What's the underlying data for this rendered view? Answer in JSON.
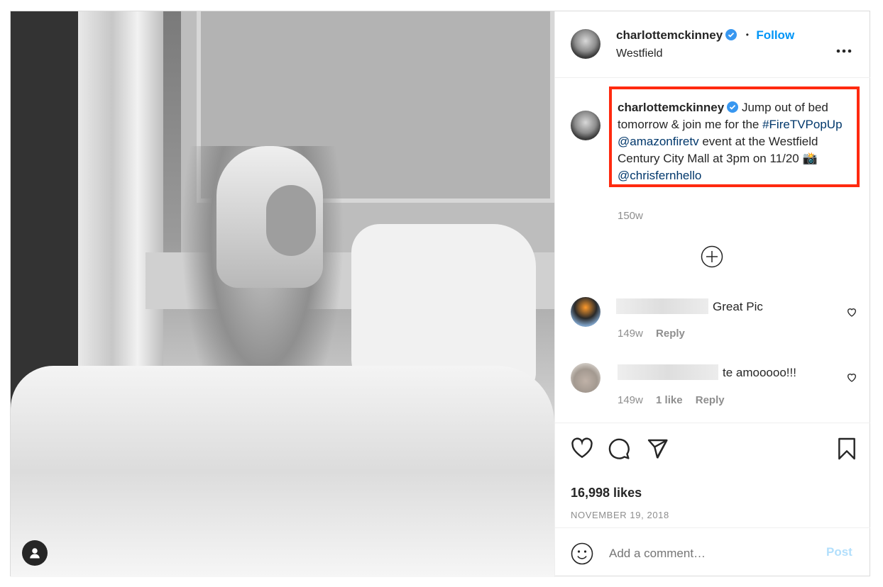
{
  "post": {
    "author": "charlottemckinney",
    "location": "Westfield",
    "follow_label": "Follow",
    "separator": "•",
    "more_label": "•••"
  },
  "caption": {
    "author": "charlottemckinney",
    "text_1": "Jump out of bed tomorrow & join me for the",
    "hashtag": "#FireTVPopUp",
    "mention_1": "@amazonfiretv",
    "text_2": "event at the Westfield Century City Mall at 3pm on 11/20",
    "emoji": "📸",
    "mention_2": "@chrisfernhello",
    "time": "150w"
  },
  "comments": [
    {
      "text": "Great Pic",
      "time": "149w",
      "reply_label": "Reply"
    },
    {
      "text": "te amooooo!!!",
      "time": "149w",
      "likes": "1 like",
      "reply_label": "Reply"
    }
  ],
  "stats": {
    "likes": "16,998 likes",
    "date": "NOVEMBER 19, 2018"
  },
  "add_comment": {
    "placeholder": "Add a comment…",
    "post_label": "Post"
  },
  "colors": {
    "link": "#00376b",
    "follow": "#0095f6",
    "highlight_box": "#ff2a0f",
    "post_disabled": "#b2dffc"
  },
  "icons": [
    "verified-badge-icon",
    "more-icon",
    "load-more-icon",
    "heart-icon",
    "comment-icon",
    "share-icon",
    "bookmark-icon",
    "emoji-icon",
    "user-tag-icon"
  ]
}
